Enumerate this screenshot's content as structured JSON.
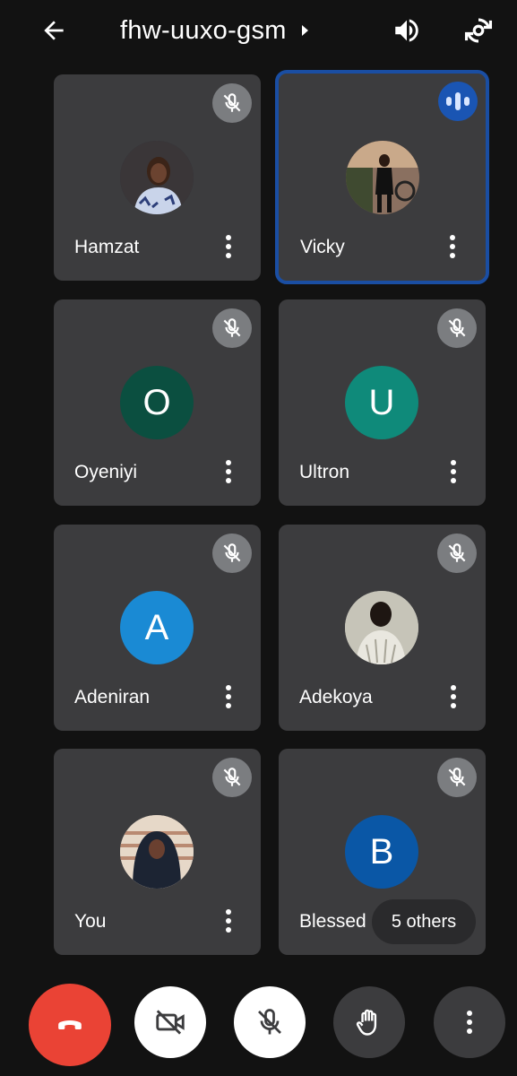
{
  "header": {
    "meeting_code": "fhw-uuxo-gsm",
    "back_icon": "arrow-left-icon",
    "speaker_icon": "volume-up-icon",
    "switch_camera_icon": "switch-camera-icon"
  },
  "participants": [
    {
      "name": "Hamzat",
      "avatar_type": "photo",
      "initial": "",
      "mic": "muted"
    },
    {
      "name": "Vicky",
      "avatar_type": "photo",
      "initial": "",
      "mic": "speaking"
    },
    {
      "name": "Oyeniyi",
      "avatar_type": "letter",
      "initial": "O",
      "color": "#0b4f40",
      "mic": "muted"
    },
    {
      "name": "Ultron",
      "avatar_type": "letter",
      "initial": "U",
      "color": "#0f8a7a",
      "mic": "muted"
    },
    {
      "name": "Adeniran",
      "avatar_type": "letter",
      "initial": "A",
      "color": "#1a8ad4",
      "mic": "muted"
    },
    {
      "name": "Adekoya",
      "avatar_type": "photo",
      "initial": "",
      "mic": "muted"
    },
    {
      "name": "You",
      "avatar_type": "photo",
      "initial": "",
      "mic": "muted"
    },
    {
      "name": "Blessed",
      "avatar_type": "letter",
      "initial": "B",
      "color": "#0a57a6",
      "mic": "muted"
    }
  ],
  "others_chip": "5 others",
  "controls": {
    "end_call_icon": "end-call-icon",
    "camera_icon": "camera-off-icon",
    "mic_icon": "mic-off-icon",
    "hand_icon": "raise-hand-icon",
    "more_icon": "more-vert-icon"
  },
  "colors": {
    "background": "#121212",
    "tile": "#3c3c3e",
    "active_speaker_border": "#1a4ea3",
    "end_call": "#ea4335"
  }
}
